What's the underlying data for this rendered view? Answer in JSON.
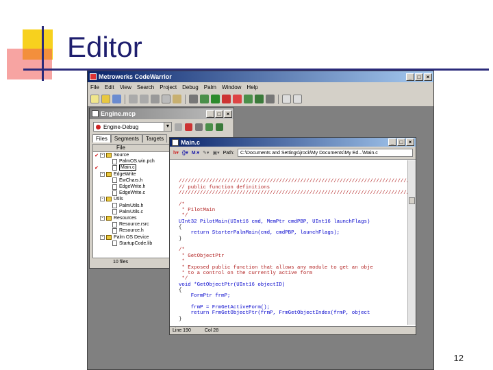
{
  "slide": {
    "title": "Editor",
    "page_number": "12"
  },
  "ide": {
    "title": "Metrowerks CodeWarrior",
    "menu": [
      "File",
      "Edit",
      "View",
      "Search",
      "Project",
      "Debug",
      "Palm",
      "Window",
      "Help"
    ]
  },
  "project_window": {
    "title": "Engine.mcp",
    "target": "Engine-Debug",
    "tabs": [
      "Files",
      "Segments",
      "Targets"
    ],
    "column_header": "File",
    "rows": [
      {
        "label": "Source",
        "type": "folder",
        "level": 0,
        "mark": "✔",
        "expander": "-"
      },
      {
        "label": "PalmOS.win.pch",
        "type": "file",
        "level": 1,
        "mark": "",
        "expander": ""
      },
      {
        "label": "Main.c",
        "type": "file",
        "level": 1,
        "mark": "✔",
        "expander": "",
        "selected": true
      },
      {
        "label": "EdgeWrite",
        "type": "folder",
        "level": 0,
        "mark": "",
        "expander": "-"
      },
      {
        "label": "EwChars.h",
        "type": "file",
        "level": 1,
        "mark": "",
        "expander": ""
      },
      {
        "label": "EdgeWrite.h",
        "type": "file",
        "level": 1,
        "mark": "",
        "expander": ""
      },
      {
        "label": "EdgeWrite.c",
        "type": "file",
        "level": 1,
        "mark": "",
        "expander": ""
      },
      {
        "label": "Utils",
        "type": "folder",
        "level": 0,
        "mark": "",
        "expander": "-"
      },
      {
        "label": "PalmUtils.h",
        "type": "file",
        "level": 1,
        "mark": "",
        "expander": ""
      },
      {
        "label": "PalmUtils.c",
        "type": "file",
        "level": 1,
        "mark": "",
        "expander": ""
      },
      {
        "label": "Resources",
        "type": "folder",
        "level": 0,
        "mark": "",
        "expander": "-"
      },
      {
        "label": "Resource.rsrc",
        "type": "file",
        "level": 1,
        "mark": "",
        "expander": ""
      },
      {
        "label": "Resource.h",
        "type": "file",
        "level": 1,
        "mark": "",
        "expander": ""
      },
      {
        "label": "Palm OS Device",
        "type": "folder",
        "level": 0,
        "mark": "",
        "expander": "-"
      },
      {
        "label": "StartupCode.lib",
        "type": "file",
        "level": 1,
        "mark": "",
        "expander": ""
      }
    ],
    "status": "10 files"
  },
  "editor_window": {
    "title": "Main.c",
    "path_label": "Path:",
    "path": "C:\\Documents and Settings\\jrock\\My Documents\\My Ed...\\Main.c",
    "lines": [
      {
        "text": "",
        "style": "plain"
      },
      {
        "text": "////////////////////////////////////////////////////////////////////////////",
        "style": "comment"
      },
      {
        "text": "// public function definitions",
        "style": "comment"
      },
      {
        "text": "////////////////////////////////////////////////////////////////////////////",
        "style": "comment"
      },
      {
        "text": "",
        "style": "plain"
      },
      {
        "text": "/*",
        "style": "comment"
      },
      {
        "text": " * PilotMain",
        "style": "comment"
      },
      {
        "text": " */",
        "style": "comment"
      },
      {
        "text": "UInt32 PilotMain(UInt16 cmd, MemPtr cmdPBP, UInt16 launchFlags)",
        "style": "mixed1"
      },
      {
        "text": "{",
        "style": "plain"
      },
      {
        "text": "    return StarterPalmMain(cmd, cmdPBP, launchFlags);",
        "style": "mixed2"
      },
      {
        "text": "}",
        "style": "plain"
      },
      {
        "text": "",
        "style": "plain"
      },
      {
        "text": "/*",
        "style": "comment"
      },
      {
        "text": " * GetObjectPtr",
        "style": "comment"
      },
      {
        "text": " *",
        "style": "comment"
      },
      {
        "text": " * Exposed public function that allows any module to get an obje",
        "style": "comment"
      },
      {
        "text": " * to a control on the currently active form",
        "style": "comment"
      },
      {
        "text": " */",
        "style": "comment"
      },
      {
        "text": "void *GetObjectPtr(UInt16 objectID)",
        "style": "mixed3"
      },
      {
        "text": "{",
        "style": "plain"
      },
      {
        "text": "    FormPtr frmP;",
        "style": "mixed4"
      },
      {
        "text": "",
        "style": "plain"
      },
      {
        "text": "    frmP = FrmGetActiveForm();",
        "style": "mixed5"
      },
      {
        "text": "    return FrmGetObjectPtr(frmP, FrmGetObjectIndex(frmP, object",
        "style": "mixed6"
      },
      {
        "text": "}",
        "style": "plain"
      }
    ],
    "status_line": "Line 190",
    "status_col": "Col 28"
  }
}
